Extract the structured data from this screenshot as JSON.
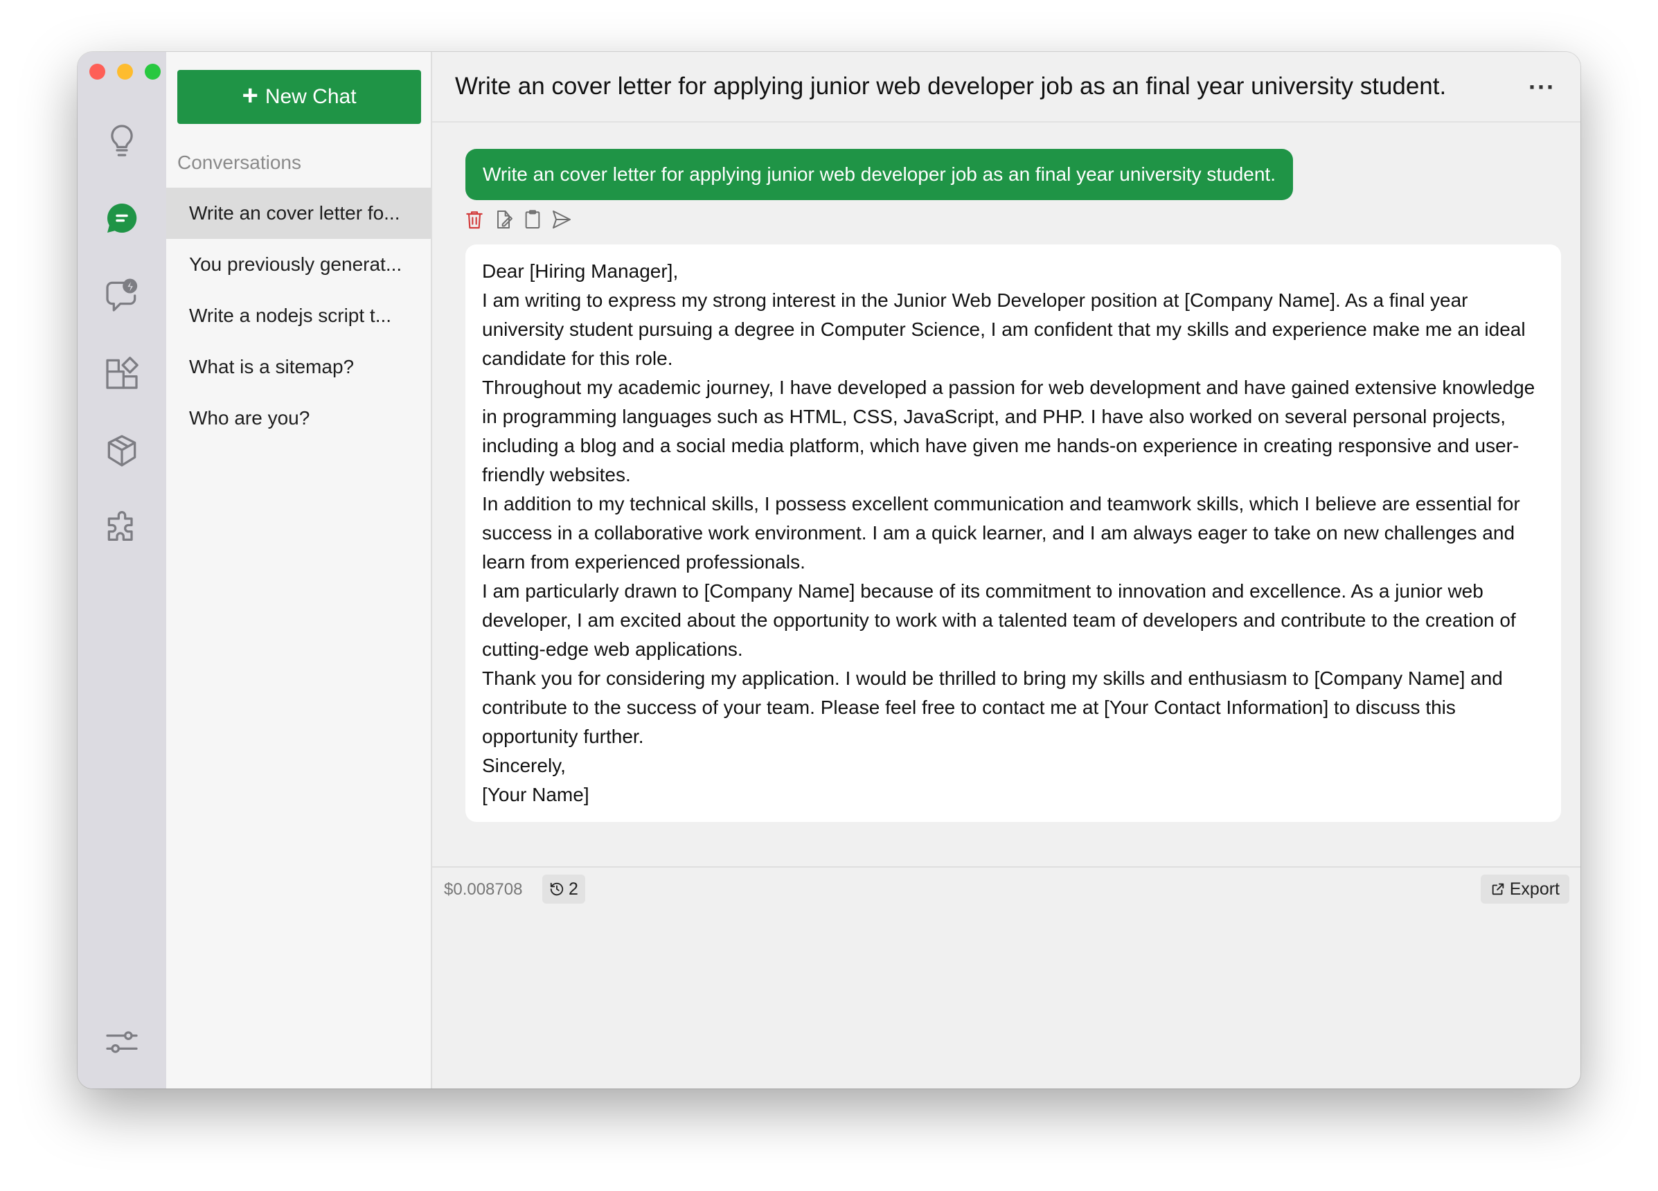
{
  "window": {
    "traffic_colors": [
      "#fe5f57",
      "#febc2e",
      "#28c840"
    ]
  },
  "rail": {
    "icons": [
      "lightbulb-icon",
      "chat-icon",
      "chat-bolt-icon",
      "apps-icon",
      "box-icon",
      "puzzle-icon",
      "sliders-icon"
    ],
    "active_icon": "chat-icon",
    "accent": "#1f9446"
  },
  "sidebar": {
    "new_chat_label": "New Chat",
    "conversations_heading": "Conversations",
    "items": [
      {
        "label": "Write an cover letter fo..."
      },
      {
        "label": "You previously generat..."
      },
      {
        "label": "Write a nodejs script t..."
      },
      {
        "label": "What is a sitemap?"
      },
      {
        "label": "Who are you?"
      }
    ]
  },
  "header": {
    "title": "Write an cover letter for applying junior web developer job as an final year university student.",
    "more_label": "···"
  },
  "chat": {
    "user_message": "Write an cover letter for applying junior web developer job as an final year university student.",
    "reply_paragraphs": [
      "Dear [Hiring Manager],",
      "I am writing to express my strong interest in the Junior Web Developer position at [Company Name]. As a final year university student pursuing a degree in Computer Science, I am confident that my skills and experience make me an ideal candidate for this role.",
      "Throughout my academic journey, I have developed a passion for web development and have gained extensive knowledge in programming languages such as HTML, CSS, JavaScript, and PHP. I have also worked on several personal projects, including a blog and a social media platform, which have given me hands-on experience in creating responsive and user-friendly websites.",
      "In addition to my technical skills, I possess excellent communication and teamwork skills, which I believe are essential for success in a collaborative work environment. I am a quick learner, and I am always eager to take on new challenges and learn from experienced professionals.",
      "I am particularly drawn to [Company Name] because of its commitment to innovation and excellence. As a junior web developer, I am excited about the opportunity to work with a talented team of developers and contribute to the creation of cutting-edge web applications.",
      "Thank you for considering my application. I would be thrilled to bring my skills and enthusiasm to [Company Name] and contribute to the success of your team. Please feel free to contact me at [Your Contact Information] to discuss this opportunity further.",
      "Sincerely,",
      "[Your Name]"
    ]
  },
  "footer": {
    "cost": "$0.008708",
    "history_count": "2",
    "export_label": "Export"
  }
}
